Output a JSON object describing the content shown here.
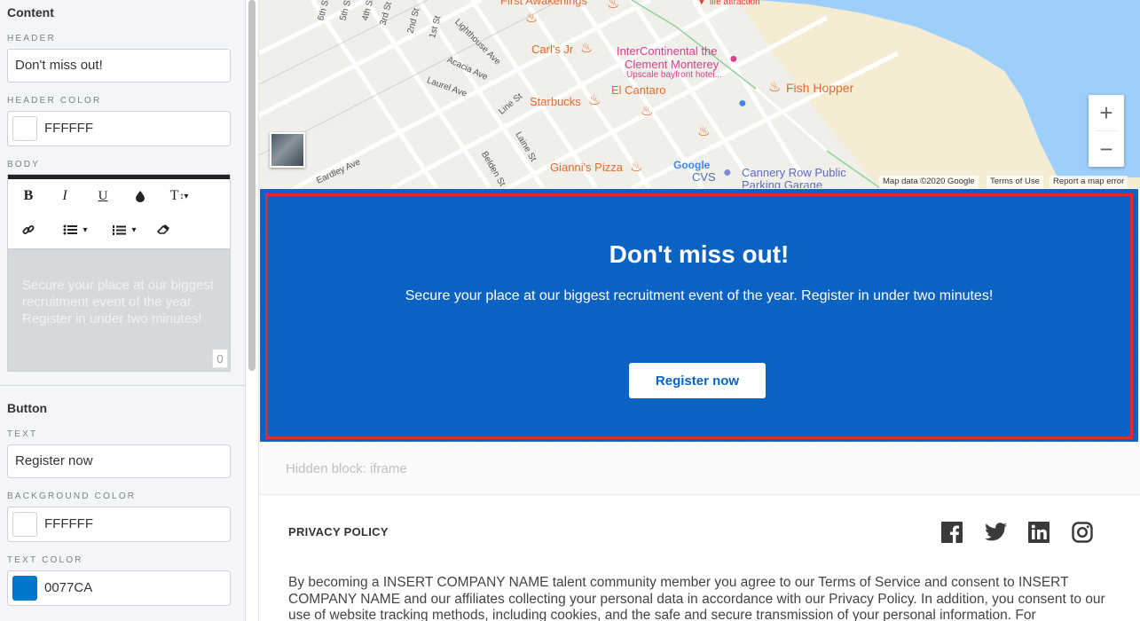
{
  "colors": {
    "promo_bg": "#0077CA",
    "selection_outline": "#E62A2A",
    "panel_bg": "#F3F5F8"
  },
  "left_panel": {
    "content_title": "Content",
    "header_label": "HEADER",
    "header_value": "Don't miss out!",
    "header_color_label": "HEADER COLOR",
    "header_color_value": "FFFFFF",
    "header_color_swatch": "#FFFFFF",
    "body_label": "BODY",
    "toolbar": {
      "bold": "B",
      "italic": "I",
      "underline": "U",
      "color_icon": "ink-drop-icon",
      "text_size": "T",
      "link_icon": "link-icon",
      "bullet_list_icon": "bullet-list-icon",
      "numbered_list_icon": "numbered-list-icon",
      "clear_format_icon": "eraser-icon"
    },
    "body_text": "Secure your place at our biggest recruitment event of the year. Register in under two minutes!",
    "body_counter": "0",
    "button_title": "Button",
    "text_label": "TEXT",
    "text_value": "Register now",
    "bg_color_label": "BACKGROUND COLOR",
    "bg_color_value": "FFFFFF",
    "bg_color_swatch": "#FFFFFF",
    "text_color_label": "TEXT COLOR",
    "text_color_value": "0077CA",
    "text_color_swatch": "#0077CA"
  },
  "map": {
    "places": {
      "first_awakenings": "First Awakenings",
      "carls_jr": "Carl's Jr",
      "intercontinental_1": "InterContinental the",
      "intercontinental_2": "Clement Monterey",
      "intercontinental_sub": "Upscale bayfront hotel...",
      "starbucks": "Starbucks",
      "el_cantaro": "El Cantaro",
      "fish_hopper": "Fish Hopper",
      "giannis": "Gianni's Pizza",
      "cvs": "CVS",
      "cannery_1": "Cannery Row Public",
      "cannery_2": "Parking Garage",
      "life_attraction": "life attraction",
      "google": "Google"
    },
    "streets": {
      "lighthouse": "Lighthouse Ave",
      "acacia": "Acacia Ave",
      "laurel": "Laurel Ave",
      "line": "Line St",
      "laine": "Laine St",
      "belden": "Belden St",
      "eardley": "Eardley Ave",
      "first": "1st St",
      "second": "2nd St",
      "third": "3rd St",
      "fourth": "4th St",
      "fifth": "5th St",
      "sixth": "6th St"
    },
    "zoom_in": "+",
    "zoom_out": "−",
    "attribution_data": "Map data ©2020 Google",
    "attribution_terms": "Terms of Use",
    "attribution_report": "Report a map error"
  },
  "promo": {
    "header": "Don't miss out!",
    "body": "Secure your place at our biggest recruitment event of the year. Register in under two minutes!",
    "button": "Register now"
  },
  "hidden_block": "Hidden block: iframe",
  "footer": {
    "privacy_title": "PRIVACY POLICY",
    "social": [
      "facebook-icon",
      "twitter-icon",
      "linkedin-icon",
      "instagram-icon"
    ],
    "legal": "By becoming a INSERT COMPANY NAME talent community member you agree to our Terms of Service and consent to INSERT COMPANY NAME and our affiliates collecting your personal data in accordance with our Privacy Policy. In addition, you consent to our use of website tracking methods, including cookies, and the safe and secure transmission of your personal information. For"
  }
}
